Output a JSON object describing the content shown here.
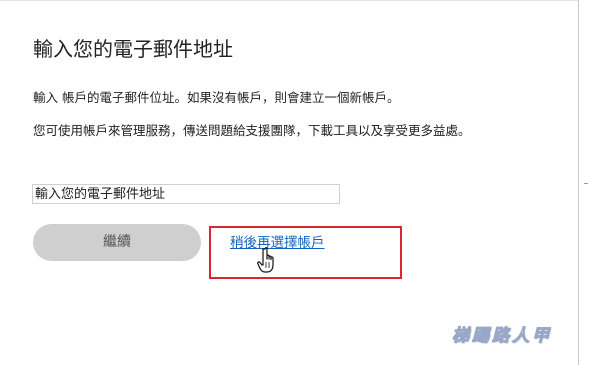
{
  "dialog": {
    "title": "輸入您的電子郵件地址",
    "paragraph_1": "輸入 帳戶的電子郵件位址。如果沒有帳戶，則會建立一個新帳戶。",
    "paragraph_2": "您可使用帳戶來管理服務，傳送問題給支援團隊，下載工具以及享受更多益處。"
  },
  "email_field": {
    "placeholder": "輸入您的電子郵件地址",
    "value": ""
  },
  "buttons": {
    "continue_label": "繼續",
    "later_link_label": "稍後再選擇帳戶"
  },
  "watermark": {
    "text": "梯踢路人甲"
  },
  "colors": {
    "highlight_border": "#d9262f",
    "link": "#1565c0",
    "button_disabled_bg": "#cfcfcf"
  },
  "icons": {
    "cursor": "hand-pointer-icon"
  }
}
